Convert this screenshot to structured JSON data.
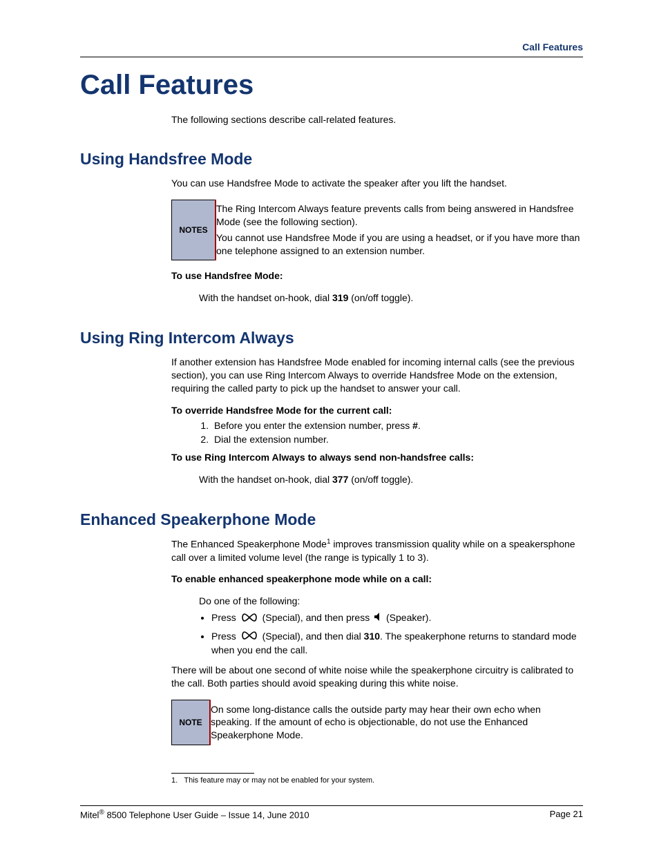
{
  "header": {
    "breadcrumb": "Call Features"
  },
  "chapter": {
    "title": "Call Features"
  },
  "intro": "The following sections describe call-related features.",
  "sec1": {
    "title": "Using Handsfree Mode",
    "para": "You can use Handsfree Mode to activate the speaker after you lift the handset.",
    "notes_label": "NOTES",
    "note1": "The Ring Intercom Always feature prevents calls from being answered in Handsfree Mode (see the following section).",
    "note2": "You cannot use Handsfree Mode if you are using a headset, or if you have more than one telephone assigned to an extension number.",
    "sub": "To use Handsfree Mode:",
    "step_pre": "With the handset on-hook, dial ",
    "step_code": "319",
    "step_post": " (on/off toggle)."
  },
  "sec2": {
    "title": "Using Ring Intercom Always",
    "para": "If another extension has Handsfree Mode enabled for incoming internal calls (see the previous section), you can use Ring Intercom Always to override Handsfree Mode on the extension, requiring the called party to pick up the handset to answer your call.",
    "subA": "To override Handsfree Mode for the current call:",
    "step1_pre": "Before you enter the extension number, press ",
    "step1_key": "#",
    "step1_post": ".",
    "step2": "Dial the extension number.",
    "subB": "To use Ring Intercom Always to always send non-handsfree calls:",
    "stepB_pre": "With the handset on-hook, dial ",
    "stepB_code": "377",
    "stepB_post": " (on/off toggle)."
  },
  "sec3": {
    "title": "Enhanced Speakerphone Mode",
    "para_pre": "The Enhanced Speakerphone Mode",
    "para_sup": "1",
    "para_post": " improves transmission quality while on a speakersphone call over a limited volume level (the range is typically 1 to 3).",
    "sub": "To enable enhanced speakerphone mode while on a call:",
    "lead": "Do one of the following:",
    "b1_a": "Press ",
    "b1_b": " (Special), and then press ",
    "b1_c": " (Speaker).",
    "b2_a": "Press ",
    "b2_b": " (Special), and then dial ",
    "b2_code": "310",
    "b2_c": ". The speakerphone returns to standard mode when you end the call.",
    "para2": "There will be about one second of white noise while the speakerphone circuitry is calibrated to the call. Both parties should avoid speaking during this white noise.",
    "note_label": "NOTE",
    "note": "On some long-distance calls the outside party may hear their own echo when speaking. If the amount of echo is objectionable, do not use the Enhanced Speakerphone Mode."
  },
  "footnote": {
    "num": "1.",
    "text": "This feature may or may not be enabled for your system."
  },
  "footer": {
    "left_pre": "Mitel",
    "left_sup": "®",
    "left_post": " 8500 Telephone User Guide – Issue 14, June 2010",
    "right": "Page 21"
  }
}
